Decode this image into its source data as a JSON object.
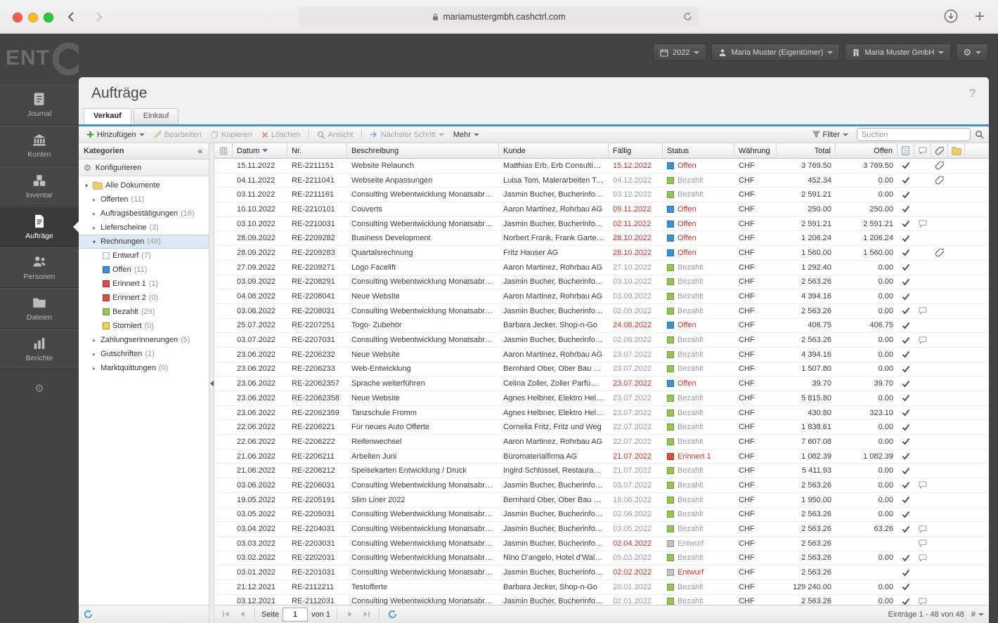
{
  "browser": {
    "url": "mariamustergmbh.cashctrl.com"
  },
  "app_header": {
    "logo_text": "ENT",
    "fiscal_year": "2022",
    "user": "Maria Muster (Eigentümer)",
    "company": "Maria Muster GmbH"
  },
  "sidebar": {
    "items": [
      {
        "label": "Journal"
      },
      {
        "label": "Konten"
      },
      {
        "label": "Inventar"
      },
      {
        "label": "Aufträge",
        "active": true
      },
      {
        "label": "Personen"
      },
      {
        "label": "Dateien"
      },
      {
        "label": "Berichte"
      }
    ]
  },
  "page": {
    "title": "Aufträge",
    "help": "?"
  },
  "tabs": [
    {
      "label": "Verkauf",
      "active": true
    },
    {
      "label": "Einkauf",
      "active": false
    }
  ],
  "toolbar": {
    "add": "Hinzufügen",
    "edit": "Bearbeiten",
    "copy": "Kopieren",
    "delete": "Löschen",
    "view": "Ansicht",
    "next_step": "Nächster Schritt",
    "more": "Mehr",
    "filter": "Filter",
    "search_placeholder": "Suchen"
  },
  "categories": {
    "title": "Kategorien",
    "collapse": "«",
    "configure": "Konfigurieren",
    "tree": [
      {
        "level": 0,
        "label": "Alle Dokumente",
        "expanded": true,
        "icon": "folder"
      },
      {
        "level": 1,
        "label": "Offerten",
        "count": "(11)",
        "expandable": true
      },
      {
        "level": 1,
        "label": "Auftragsbestätigungen",
        "count": "(16)",
        "expandable": true
      },
      {
        "level": 1,
        "label": "Lieferscheine",
        "count": "(3)",
        "expandable": true
      },
      {
        "level": 1,
        "label": "Rechnungen",
        "count": "(48)",
        "expanded": true,
        "selected": true
      },
      {
        "level": 2,
        "label": "Entwurf",
        "count": "(7)",
        "square": "#f4f4f4"
      },
      {
        "level": 2,
        "label": "Offen",
        "count": "(11)",
        "square": "#3892d3"
      },
      {
        "level": 2,
        "label": "Erinnert 1",
        "count": "(1)",
        "square": "#df4b41"
      },
      {
        "level": 2,
        "label": "Erinnert 2",
        "count": "(0)",
        "square": "#df4b41"
      },
      {
        "level": 2,
        "label": "Bezahlt",
        "count": "(29)",
        "square": "#95c653"
      },
      {
        "level": 2,
        "label": "Storniert",
        "count": "(0)",
        "square": "#f3cf4a"
      },
      {
        "level": 1,
        "label": "Zahlungserinnerungen",
        "count": "(5)",
        "expandable": true
      },
      {
        "level": 1,
        "label": "Gutschriften",
        "count": "(1)",
        "expandable": true
      },
      {
        "level": 1,
        "label": "Marktquittungen",
        "count": "(0)",
        "expandable": true
      }
    ]
  },
  "grid": {
    "columns": {
      "datum": "Datum",
      "nr": "Nr.",
      "beschreibung": "Beschreibung",
      "kunde": "Kunde",
      "faellig": "Fällig",
      "status": "Status",
      "waehrung": "Währung",
      "total": "Total",
      "offen": "Offen"
    },
    "status_colors": {
      "Offen": "#3892d3",
      "Bezahlt": "#95c653",
      "Erinnert 1": "#df4b41",
      "Entwurf": "#c2c2c2"
    },
    "rows": [
      {
        "datum": "15.11.2022",
        "nr": "RE-2211151",
        "beschreibung": "Website Relaunch",
        "kunde": "Matthias Erb, Erb Consulting AG",
        "faellig": "15.12.2022",
        "overdue": true,
        "status": "Offen",
        "status_red": true,
        "waehrung": "CHF",
        "total": "3 769.50",
        "offen": "3 769.50",
        "booked": true,
        "comment": false,
        "attach": true
      },
      {
        "datum": "04.11.2022",
        "nr": "RE-2211041",
        "beschreibung": "Webseite Anpassungen",
        "kunde": "Luisa Tom, Malerarbeiten Tom",
        "faellig": "04.12.2022",
        "overdue": false,
        "status": "Bezahlt",
        "status_red": false,
        "waehrung": "CHF",
        "total": "452.34",
        "offen": "0.00",
        "booked": true,
        "comment": false,
        "attach": true
      },
      {
        "datum": "03.11.2022",
        "nr": "RE-2211161",
        "beschreibung": "Consulting Webentwicklung Monatsabrech…",
        "kunde": "Jasmin Bucher, Bucherinformat…",
        "faellig": "03.12.2022",
        "overdue": false,
        "status": "Bezahlt",
        "status_red": false,
        "waehrung": "CHF",
        "total": "2 591.21",
        "offen": "0.00",
        "booked": true,
        "comment": false,
        "attach": false
      },
      {
        "datum": "10.10.2022",
        "nr": "RE-2210101",
        "beschreibung": "Couverts",
        "kunde": "Aaron Martinez, Rohrbau AG",
        "faellig": "09.11.2022",
        "overdue": true,
        "status": "Offen",
        "status_red": true,
        "waehrung": "CHF",
        "total": "250.00",
        "offen": "250.00",
        "booked": true,
        "comment": false,
        "attach": false
      },
      {
        "datum": "03.10.2022",
        "nr": "RE-2210031",
        "beschreibung": "Consulting Webentwicklung Monatsabrech…",
        "kunde": "Jasmin Bucher, Bucherinformat…",
        "faellig": "02.11.2022",
        "overdue": true,
        "status": "Offen",
        "status_red": true,
        "waehrung": "CHF",
        "total": "2 591.21",
        "offen": "2 591.21",
        "booked": true,
        "comment": true,
        "attach": false
      },
      {
        "datum": "28.09.2022",
        "nr": "RE-2209282",
        "beschreibung": "Business Development",
        "kunde": "Norbert Frank, Frank Gartenbau",
        "faellig": "28.10.2022",
        "overdue": true,
        "status": "Offen",
        "status_red": true,
        "waehrung": "CHF",
        "total": "1 206.24",
        "offen": "1 206.24",
        "booked": true,
        "comment": false,
        "attach": false
      },
      {
        "datum": "28.09.2022",
        "nr": "RE-2209283",
        "beschreibung": "Quartalsrechnung",
        "kunde": "Fritz Hauser AG",
        "faellig": "28.10.2022",
        "overdue": true,
        "status": "Offen",
        "status_red": true,
        "waehrung": "CHF",
        "total": "1 560.00",
        "offen": "1 560.00",
        "booked": true,
        "comment": false,
        "attach": true
      },
      {
        "datum": "27.09.2022",
        "nr": "RE-2209271",
        "beschreibung": "Logo Facelift",
        "kunde": "Aaron Martinez, Rohrbau AG",
        "faellig": "27.10.2022",
        "overdue": false,
        "status": "Bezahlt",
        "status_red": false,
        "waehrung": "CHF",
        "total": "1 292.40",
        "offen": "0.00",
        "booked": true,
        "comment": false,
        "attach": false
      },
      {
        "datum": "03.09.2022",
        "nr": "RE-2208291",
        "beschreibung": "Consulting Webentwicklung Monatsabrech…",
        "kunde": "Jasmin Bucher, Bucherinformat…",
        "faellig": "03.10.2022",
        "overdue": false,
        "status": "Bezahlt",
        "status_red": false,
        "waehrung": "CHF",
        "total": "2 563.26",
        "offen": "0.00",
        "booked": true,
        "comment": false,
        "attach": false
      },
      {
        "datum": "04.08.2022",
        "nr": "RE-2208041",
        "beschreibung": "Neue Website",
        "kunde": "Aaron Martinez, Rohrbau AG",
        "faellig": "03.09.2022",
        "overdue": false,
        "status": "Bezahlt",
        "status_red": false,
        "waehrung": "CHF",
        "total": "4 394.16",
        "offen": "0.00",
        "booked": true,
        "comment": false,
        "attach": false
      },
      {
        "datum": "03.08.2022",
        "nr": "RE-2208031",
        "beschreibung": "Consulting Webentwicklung Monatsabrech…",
        "kunde": "Jasmin Bucher, Bucherinformat…",
        "faellig": "02.09.2022",
        "overdue": false,
        "status": "Bezahlt",
        "status_red": false,
        "waehrung": "CHF",
        "total": "2 563.26",
        "offen": "0.00",
        "booked": true,
        "comment": true,
        "attach": false
      },
      {
        "datum": "25.07.2022",
        "nr": "RE-2207251",
        "beschreibung": "Togo- Zubehör",
        "kunde": "Barbara Jecker, Shop-n-Go",
        "faellig": "24.08.2022",
        "overdue": true,
        "status": "Offen",
        "status_red": true,
        "waehrung": "CHF",
        "total": "406.75",
        "offen": "406.75",
        "booked": true,
        "comment": false,
        "attach": false
      },
      {
        "datum": "03.07.2022",
        "nr": "RE-2207031",
        "beschreibung": "Consulting Webentwicklung Monatsabrech…",
        "kunde": "Jasmin Bucher, Bucherinformat…",
        "faellig": "02.08.2022",
        "overdue": false,
        "status": "Bezahlt",
        "status_red": false,
        "waehrung": "CHF",
        "total": "2 563.26",
        "offen": "0.00",
        "booked": true,
        "comment": true,
        "attach": false
      },
      {
        "datum": "23.06.2022",
        "nr": "RE-2206232",
        "beschreibung": "Neue Website",
        "kunde": "Aaron Martinez, Rohrbau AG",
        "faellig": "23.07.2022",
        "overdue": false,
        "status": "Bezahlt",
        "status_red": false,
        "waehrung": "CHF",
        "total": "4 394.16",
        "offen": "0.00",
        "booked": true,
        "comment": false,
        "attach": false
      },
      {
        "datum": "23.06.2022",
        "nr": "RE-2206233",
        "beschreibung": "Web-Entwicklung",
        "kunde": "Bernhard Ober, Ober Bau und …",
        "faellig": "23.07.2022",
        "overdue": false,
        "status": "Bezahlt",
        "status_red": false,
        "waehrung": "CHF",
        "total": "1 507.80",
        "offen": "0.00",
        "booked": true,
        "comment": false,
        "attach": false
      },
      {
        "datum": "23.06.2022",
        "nr": "RE-22062357",
        "beschreibung": "Sprache weiterführen",
        "kunde": "Celina Zoller, Zoller Parfümerie…",
        "faellig": "23.07.2022",
        "overdue": true,
        "status": "Offen",
        "status_red": true,
        "waehrung": "CHF",
        "total": "39.70",
        "offen": "39.70",
        "booked": true,
        "comment": false,
        "attach": false
      },
      {
        "datum": "23.06.2022",
        "nr": "RE-22062358",
        "beschreibung": "Neue Website",
        "kunde": "Agnes Helbner, Elektro Helbne…",
        "faellig": "23.07.2022",
        "overdue": false,
        "status": "Bezahlt",
        "status_red": false,
        "waehrung": "CHF",
        "total": "5 815.80",
        "offen": "0.00",
        "booked": true,
        "comment": false,
        "attach": false
      },
      {
        "datum": "23.06.2022",
        "nr": "RE-22062359",
        "beschreibung": "Tanzschule Fromm",
        "kunde": "Agnes Helbner, Elektro Helbne…",
        "faellig": "23.07.2022",
        "overdue": false,
        "status": "Bezahlt",
        "status_red": false,
        "waehrung": "CHF",
        "total": "430.80",
        "offen": "323.10",
        "booked": true,
        "comment": false,
        "attach": false
      },
      {
        "datum": "22.06.2022",
        "nr": "RE-2206221",
        "beschreibung": "Für neues Auto Offerte",
        "kunde": "Cornelia Fritz, Fritz und Weg",
        "faellig": "22.07.2022",
        "overdue": false,
        "status": "Bezahlt",
        "status_red": false,
        "waehrung": "CHF",
        "total": "1 838.61",
        "offen": "0.00",
        "booked": true,
        "comment": false,
        "attach": false
      },
      {
        "datum": "22.06.2022",
        "nr": "RE-2206222",
        "beschreibung": "Reifenwechsel",
        "kunde": "Aaron Martinez, Rohrbau AG",
        "faellig": "22.07.2022",
        "overdue": false,
        "status": "Bezahlt",
        "status_red": false,
        "waehrung": "CHF",
        "total": "7 607.08",
        "offen": "0.00",
        "booked": true,
        "comment": false,
        "attach": false
      },
      {
        "datum": "21.06.2022",
        "nr": "RE-2206211",
        "beschreibung": "Arbeiten Juni",
        "kunde": "Büromaterialfirma AG",
        "faellig": "21.07.2022",
        "overdue": true,
        "status": "Erinnert 1",
        "status_red": true,
        "waehrung": "CHF",
        "total": "1 082.39",
        "offen": "1 082.39",
        "booked": true,
        "comment": false,
        "attach": false
      },
      {
        "datum": "21.06.2022",
        "nr": "RE-2206212",
        "beschreibung": "Speisekarten Entwicklung / Druck",
        "kunde": "Ingird Schlüssel, Restaurant S…",
        "faellig": "21.07.2022",
        "overdue": false,
        "status": "Bezahlt",
        "status_red": false,
        "waehrung": "CHF",
        "total": "5 411.93",
        "offen": "0.00",
        "booked": true,
        "comment": false,
        "attach": false
      },
      {
        "datum": "03.06.2022",
        "nr": "RE-2206031",
        "beschreibung": "Consulting Webentwicklung Monatsabrech…",
        "kunde": "Jasmin Bucher, Bucherinformat…",
        "faellig": "03.07.2022",
        "overdue": false,
        "status": "Bezahlt",
        "status_red": false,
        "waehrung": "CHF",
        "total": "2 563.26",
        "offen": "0.00",
        "booked": true,
        "comment": true,
        "attach": false
      },
      {
        "datum": "19.05.2022",
        "nr": "RE-2205191",
        "beschreibung": "Slim Liner 2022",
        "kunde": "Bernhard Ober, Ober Bau und …",
        "faellig": "18.06.2022",
        "overdue": false,
        "status": "Bezahlt",
        "status_red": false,
        "waehrung": "CHF",
        "total": "1 950.00",
        "offen": "0.00",
        "booked": true,
        "comment": false,
        "attach": false
      },
      {
        "datum": "03.05.2022",
        "nr": "RE-2205031",
        "beschreibung": "Consulting Webentwicklung Monatsabrech…",
        "kunde": "Jasmin Bucher, Bucherinformat…",
        "faellig": "02.06.2022",
        "overdue": false,
        "status": "Bezahlt",
        "status_red": false,
        "waehrung": "CHF",
        "total": "2 563.26",
        "offen": "0.00",
        "booked": true,
        "comment": false,
        "attach": false
      },
      {
        "datum": "03.04.2022",
        "nr": "RE-2204031",
        "beschreibung": "Consulting Webentwicklung Monatsabrech…",
        "kunde": "Jasmin Bucher, Bucherinformat…",
        "faellig": "03.05.2022",
        "overdue": false,
        "status": "Bezahlt",
        "status_red": false,
        "waehrung": "CHF",
        "total": "2 563.26",
        "offen": "63.26",
        "booked": true,
        "comment": true,
        "attach": false
      },
      {
        "datum": "03.03.2022",
        "nr": "RE-2203031",
        "beschreibung": "Consulting Webentwicklung Monatsabrech…",
        "kunde": "Jasmin Bucher, Bucherinformat…",
        "faellig": "02.04.2022",
        "overdue": true,
        "status": "Entwurf",
        "status_red": false,
        "waehrung": "CHF",
        "total": "2 563.26",
        "offen": "",
        "booked": false,
        "comment": true,
        "attach": false
      },
      {
        "datum": "03.02.2022",
        "nr": "RE-2202031",
        "beschreibung": "Consulting Webentwicklung Monatsabrech…",
        "kunde": "Nino D'angelo, Hotel d'Waldhü…",
        "faellig": "05.03.2022",
        "overdue": false,
        "status": "Bezahlt",
        "status_red": false,
        "waehrung": "CHF",
        "total": "2 563.26",
        "offen": "0.00",
        "booked": true,
        "comment": true,
        "attach": false
      },
      {
        "datum": "03.01.2022",
        "nr": "RE-2201031",
        "beschreibung": "Consulting Webentwicklung Monatsabrech…",
        "kunde": "Jasmin Bucher, Bucherinformat…",
        "faellig": "02.02.2022",
        "overdue": true,
        "status": "Entwurf",
        "status_red": true,
        "waehrung": "CHF",
        "total": "2 563.26",
        "offen": "",
        "booked": true,
        "comment": false,
        "attach": false
      },
      {
        "datum": "21.12.2021",
        "nr": "RE-2112211",
        "beschreibung": "Testofferte",
        "kunde": "Barbara Jecker, Shop-n-Go",
        "faellig": "20.01.2022",
        "overdue": false,
        "status": "Bezahlt",
        "status_red": false,
        "waehrung": "CHF",
        "total": "129 240.00",
        "offen": "0.00",
        "booked": true,
        "comment": false,
        "attach": false
      },
      {
        "datum": "03.12.2021",
        "nr": "RE-2112031",
        "beschreibung": "Consulting Webentwicklung Monatsabrech…",
        "kunde": "Jasmin Bucher, Bucherinformat…",
        "faellig": "02.01.2022",
        "overdue": false,
        "status": "Bezahlt",
        "status_red": false,
        "waehrung": "CHF",
        "total": "2 563.26",
        "offen": "0.00",
        "booked": true,
        "comment": true,
        "attach": false
      }
    ]
  },
  "pager": {
    "page_label": "Seite",
    "page_value": "1",
    "of_label": "von 1",
    "entries": "Einträge 1 - 48 von 48",
    "hash": "#"
  }
}
